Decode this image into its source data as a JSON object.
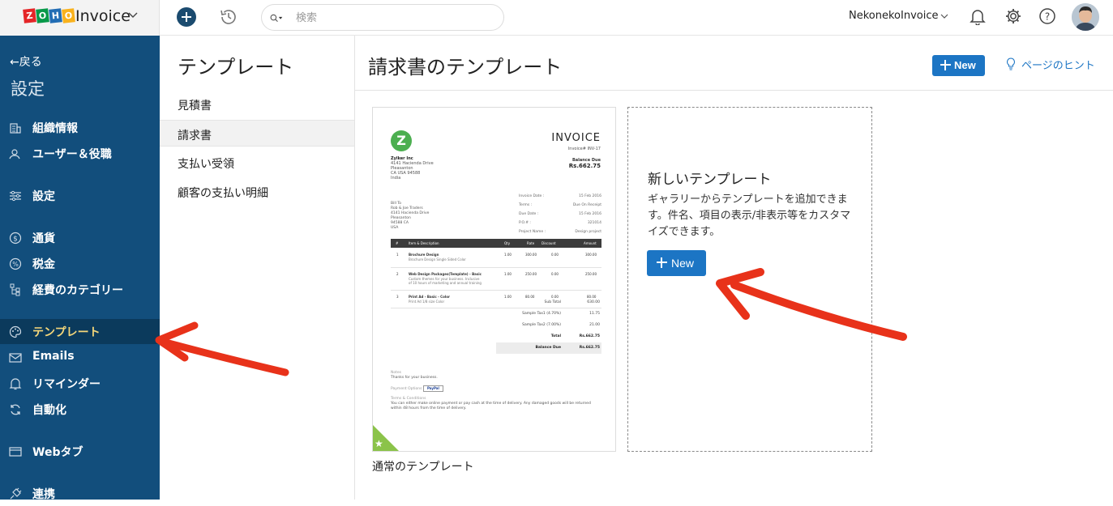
{
  "topbar": {
    "brand_logo": "ZOHO",
    "brand_name": "Invoice",
    "search_placeholder": "検索",
    "org_name": "NekonekoInvoice"
  },
  "sidebar": {
    "back_label": "←戻る",
    "title": "設定",
    "items": [
      {
        "label": "組織情報",
        "icon": "building-icon"
      },
      {
        "label": "ユーザー＆役職",
        "icon": "users-icon"
      },
      {
        "label": "設定",
        "icon": "sliders-icon"
      },
      {
        "label": "通貨",
        "icon": "currency-icon"
      },
      {
        "label": "税金",
        "icon": "percent-icon"
      },
      {
        "label": "経費のカテゴリー",
        "icon": "tree-icon"
      },
      {
        "label": "テンプレート",
        "icon": "palette-icon",
        "active": true
      },
      {
        "label": "Emails",
        "icon": "mail-icon"
      },
      {
        "label": "リマインダー",
        "icon": "bell-icon"
      },
      {
        "label": "自動化",
        "icon": "refresh-icon"
      },
      {
        "label": "Webタブ",
        "icon": "browser-icon"
      },
      {
        "label": "連携",
        "icon": "plug-icon"
      }
    ]
  },
  "subnav": {
    "title": "テンプレート",
    "items": [
      {
        "label": "見積書"
      },
      {
        "label": "請求書",
        "active": true
      },
      {
        "label": "支払い受領"
      },
      {
        "label": "顧客の支払い明細"
      }
    ]
  },
  "main": {
    "title": "請求書のテンプレート",
    "new_label": "New",
    "hint_label": "ページのヒント",
    "template_caption": "通常のテンプレート",
    "new_card": {
      "title": "新しいテンプレート",
      "description": "ギャラリーからテンプレートを追加できます。件名、項目の表示/非表示等をカスタマイズできます。",
      "button_label": "New"
    },
    "invoice_preview": {
      "logo_letter": "Z",
      "heading": "INVOICE",
      "number": "Invoice# INV-17",
      "balance_due_label": "Balance Due",
      "balance_due": "Rs.662.75",
      "org_lines": [
        "Zylker Inc",
        "4141 Hacienda Drive",
        "Pleasanton",
        "CA USA 94588",
        "India"
      ],
      "bill_to_lines": [
        "Bill To",
        "Rob & Joe Traders",
        "4141 Hacienda Drive",
        "Pleasanton",
        "94588 CA",
        "USA"
      ],
      "meta": [
        {
          "label": "Invoice Date :",
          "value": "15 Feb 2016"
        },
        {
          "label": "Terms :",
          "value": "Due On Receipt"
        },
        {
          "label": "Due Date :",
          "value": "15 Feb 2016"
        },
        {
          "label": "P.O.# :",
          "value": "321014"
        },
        {
          "label": "Project Name :",
          "value": "Design project"
        }
      ],
      "columns": [
        "#",
        "Item & Description",
        "Qty",
        "Rate",
        "Discount",
        "Amount"
      ],
      "rows": [
        {
          "n": "1",
          "item": "Brochure Design",
          "desc": "Brochure Design Single Sided Color",
          "qty": "1.00",
          "rate": "300.00",
          "disc": "0.00",
          "amt": "300.00"
        },
        {
          "n": "2",
          "item": "Web Design Packages(Template) - Basic",
          "desc": "Custom themes for your business. Inclusive of 10 hours of marketing and annual training",
          "qty": "1.00",
          "rate": "250.00",
          "disc": "0.00",
          "amt": "250.00"
        },
        {
          "n": "3",
          "item": "Print Ad - Basic - Color",
          "desc": "Print Ad 1/8 size Color",
          "qty": "1.00",
          "rate": "80.00",
          "disc": "0.00",
          "amt": "80.00"
        }
      ],
      "totals": [
        {
          "label": "Sub Total",
          "value": "630.00"
        },
        {
          "label": "Sample Tax1 (4.70%)",
          "value": "11.75"
        },
        {
          "label": "Sample Tax2 (7.00%)",
          "value": "21.00"
        },
        {
          "label": "Total",
          "value": "Rs.662.75"
        },
        {
          "label": "Balance Due",
          "value": "Rs.662.75"
        }
      ],
      "notes_label": "Notes",
      "notes": "Thanks for your business.",
      "payment_label": "Payment Options",
      "paypal": "PayPal",
      "terms_label": "Terms & Conditions",
      "terms": "You can either make online payment or pay cash at the time of delivery. Any damaged goods will be returned within 48 hours from the time of delivery."
    }
  },
  "colors": {
    "sidebar_bg": "#124e7c",
    "accent": "#1c75c4",
    "active_label": "#f5d77a",
    "annotation_arrow": "#e8321a"
  }
}
